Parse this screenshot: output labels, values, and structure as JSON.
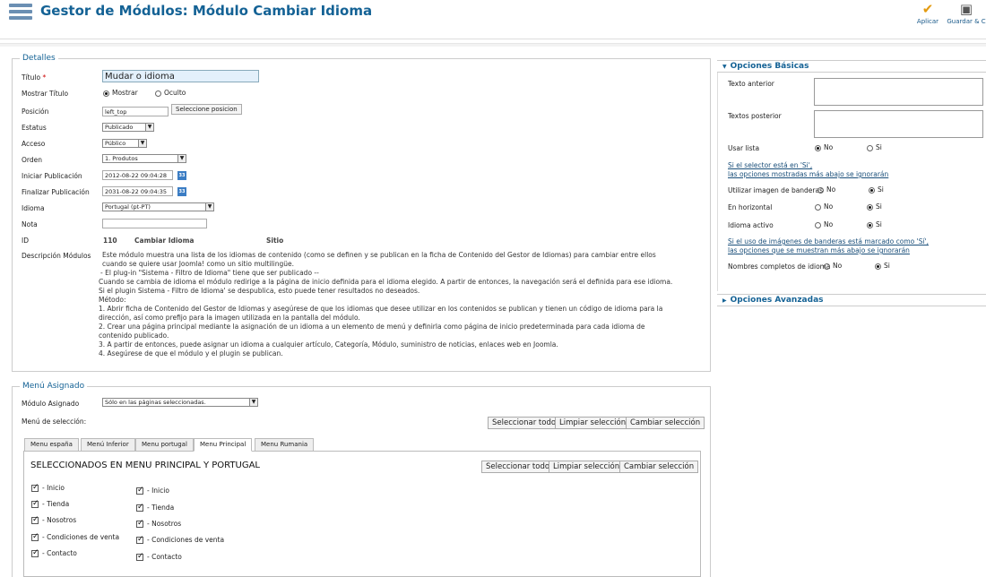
{
  "header": {
    "title": "Gestor de Módulos: Módulo Cambiar Idioma",
    "apply": "Aplicar",
    "save": "Guardar & C"
  },
  "details": {
    "legend": "Detalles",
    "title_label": "Título",
    "title_value": "Mudar o idioma",
    "required": "*",
    "show_title_label": "Mostrar Título",
    "show": "Mostrar",
    "hide": "Oculto",
    "position_label": "Posición",
    "position_value": "left_top",
    "position_btn": "Seleccione posicion",
    "status_label": "Estatus",
    "status_value": "Publicado",
    "access_label": "Acceso",
    "access_value": "Público",
    "order_label": "Orden",
    "order_value": "1. Produtos",
    "start_label": "Iniciar Publicación",
    "start_value": "2012-08-22 09:04:28",
    "end_label": "Finalizar Publicación",
    "end_value": "2031-08-22 09:04:35",
    "calendar_icon": "33",
    "lang_label": "Idioma",
    "lang_value": "Portugal (pt-PT)",
    "note_label": "Nota",
    "note_value": "",
    "id_label": "ID",
    "id_value": "110",
    "module_name": "Cambiar Idioma",
    "module_site": "Sitio",
    "desc_label": "Descripción Módulos",
    "desc_lines": [
      "Este módulo muestra una lista de los idiomas de contenido (como se definen y se publican en la ficha de Contenido del Gestor de Idiomas) para cambiar entre ellos",
      "cuando se quiere usar Joomla! como un sitio multilingüe.",
      "- El plug-in \"Sistema - Filtro de Idioma\" tiene que ser publicado --",
      "Cuando se cambia de idioma el módulo redirige a la página de inicio definida para el idioma elegido. A partir de entonces, la navegación será el definida para ese idioma.",
      "Si el plugin Sistema - Filtro de Idioma' se despublica, esto puede tener resultados no deseados.",
      "Método:",
      "1. Abrir ficha de Contenido del Gestor de Idiomas y asegúrese de que los idiomas que desee utilizar en los contenidos se publican y tienen un código de idioma para la",
      "dirección, así como prefijo para la imagen utilizada en la pantalla del módulo.",
      "2. Crear una página principal mediante la asignación de un idioma a un elemento de menú y definirla como página de inicio predeterminada para cada idioma de",
      "contenido publicado.",
      "3. A partir de entonces, puede asignar un idioma a cualquier artículo, Categoría, Módulo, suministro de noticias, enlaces web en Joomla.",
      "4. Asegúrese de que el módulo y el plugin se publican."
    ]
  },
  "menu": {
    "legend": "Menú Asignado",
    "assigned_label": "Módulo Asignado",
    "assigned_value": "Sólo en las páginas seleccionadas.",
    "selection_label": "Menú de selección:",
    "select_all": "Seleccionar todo",
    "clear": "Limpiar selección",
    "toggle": "Cambiar selección",
    "tabs": [
      "Menu españa",
      "Menú Inferior",
      "Menu portugal",
      "Menu Principal",
      "Menu Rumania"
    ],
    "panel_title": "SELECCIONADOS EN MENU PRINCIPAL Y PORTUGAL",
    "col1": [
      "- Inicio",
      "- Tienda",
      "- Nosotros",
      "- Condiciones de venta",
      "- Contacto"
    ],
    "col2": [
      "- Inicio",
      "- Tienda",
      "- Nosotros",
      "- Condiciones de venta",
      "- Contacto"
    ]
  },
  "basic": {
    "title": "Opciones Básicas",
    "text_before": "Texto anterior",
    "text_after": "Textos posterior",
    "use_list": "Usar lista",
    "no": "No",
    "yes": "Si",
    "note1a": "Si el selector está en 'Si',",
    "note1b": "las opciones mostradas más abajo se ignorarán",
    "use_flags": "Utilizar imagen de banderas",
    "horizontal": "En horizontal",
    "active_lang": "Idioma activo",
    "note2a": "Si el uso de imágenes de banderas está marcado como 'Sí',",
    "note2b": "las opciones que se muestran más abajo se ignorarán",
    "full_names": "Nombres completos de idioma"
  },
  "advanced": {
    "title": "Opciones Avanzadas"
  }
}
